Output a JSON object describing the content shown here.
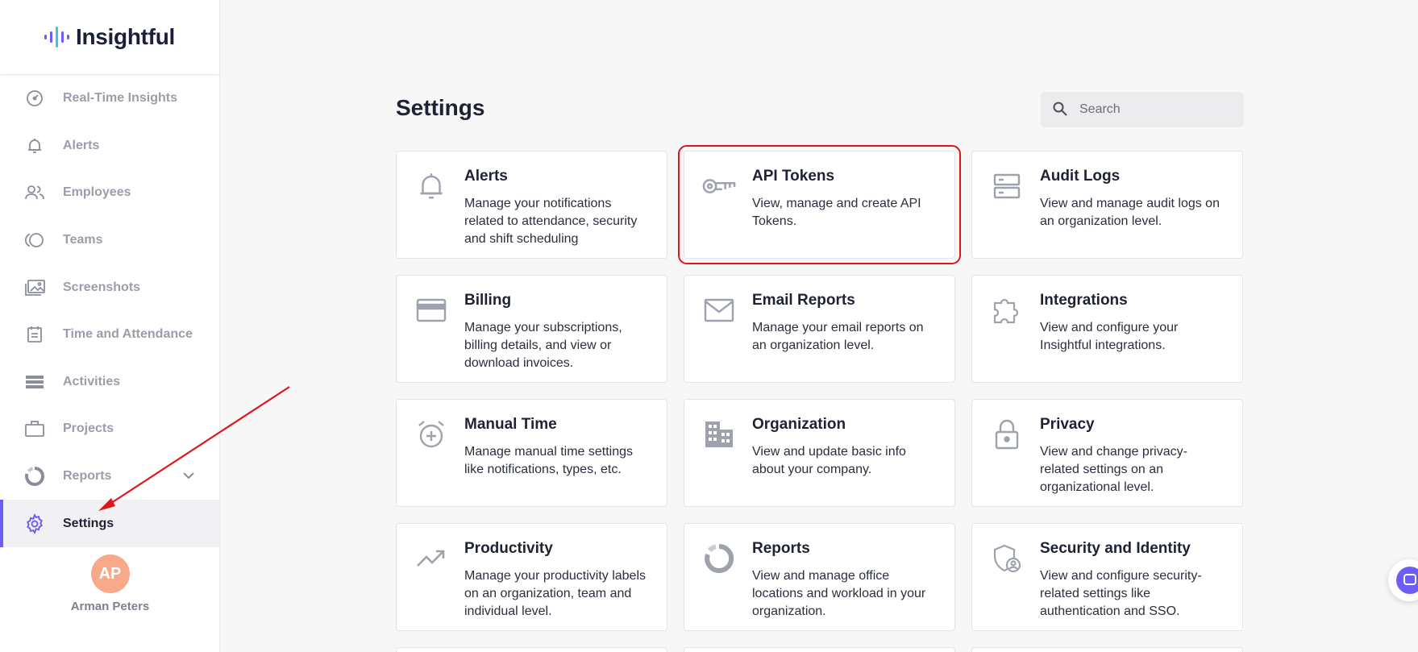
{
  "brand": {
    "name": "Insightful",
    "accent": "#6e5cf6"
  },
  "sidebar": {
    "items": [
      {
        "label": "Real-Time Insights",
        "icon": "realtime-gauge-icon"
      },
      {
        "label": "Alerts",
        "icon": "bell-icon"
      },
      {
        "label": "Employees",
        "icon": "people-icon"
      },
      {
        "label": "Teams",
        "icon": "teams-circles-icon"
      },
      {
        "label": "Screenshots",
        "icon": "images-icon"
      },
      {
        "label": "Time and Attendance",
        "icon": "calendar-icon"
      },
      {
        "label": "Activities",
        "icon": "list-icon"
      },
      {
        "label": "Projects",
        "icon": "briefcase-icon"
      },
      {
        "label": "Reports",
        "icon": "donut-chart-icon"
      },
      {
        "label": "Settings",
        "icon": "gear-icon"
      }
    ],
    "active": "Settings",
    "user": {
      "initials": "AP",
      "name": "Arman Peters"
    }
  },
  "main": {
    "title": "Settings",
    "search": {
      "placeholder": "Search"
    },
    "cards": [
      {
        "title": "Alerts",
        "description": "Manage your notifications related to attendance, security and shift scheduling",
        "icon": "bell-icon"
      },
      {
        "title": "API Tokens",
        "description": "View, manage and create API Tokens.",
        "icon": "key-icon"
      },
      {
        "title": "Audit Logs",
        "description": "View and manage audit logs on an organization level.",
        "icon": "server-icon"
      },
      {
        "title": "Billing",
        "description": "Manage your subscriptions, billing details, and view or download invoices.",
        "icon": "credit-card-icon"
      },
      {
        "title": "Email Reports",
        "description": "Manage your email reports on an organization level.",
        "icon": "envelope-icon"
      },
      {
        "title": "Integrations",
        "description": "View and configure your Insightful integrations.",
        "icon": "puzzle-icon"
      },
      {
        "title": "Manual Time",
        "description": "Manage manual time settings like notifications, types, etc.",
        "icon": "alarm-plus-icon"
      },
      {
        "title": "Organization",
        "description": "View and update basic info about your company.",
        "icon": "building-icon"
      },
      {
        "title": "Privacy",
        "description": "View and change privacy-related settings on an organizational level.",
        "icon": "lock-icon"
      },
      {
        "title": "Productivity",
        "description": "Manage your productivity labels on an organization, team and individual level.",
        "icon": "trend-up-icon"
      },
      {
        "title": "Reports",
        "description": "View and manage office locations and workload in your organization.",
        "icon": "donut-chart-icon"
      },
      {
        "title": "Security and Identity",
        "description": "View and configure security-related settings like authentication and SSO.",
        "icon": "shield-user-icon"
      }
    ],
    "highlighted_card": "API Tokens"
  },
  "colors": {
    "highlight": "#e0151b",
    "arrow": "#e0151b"
  }
}
